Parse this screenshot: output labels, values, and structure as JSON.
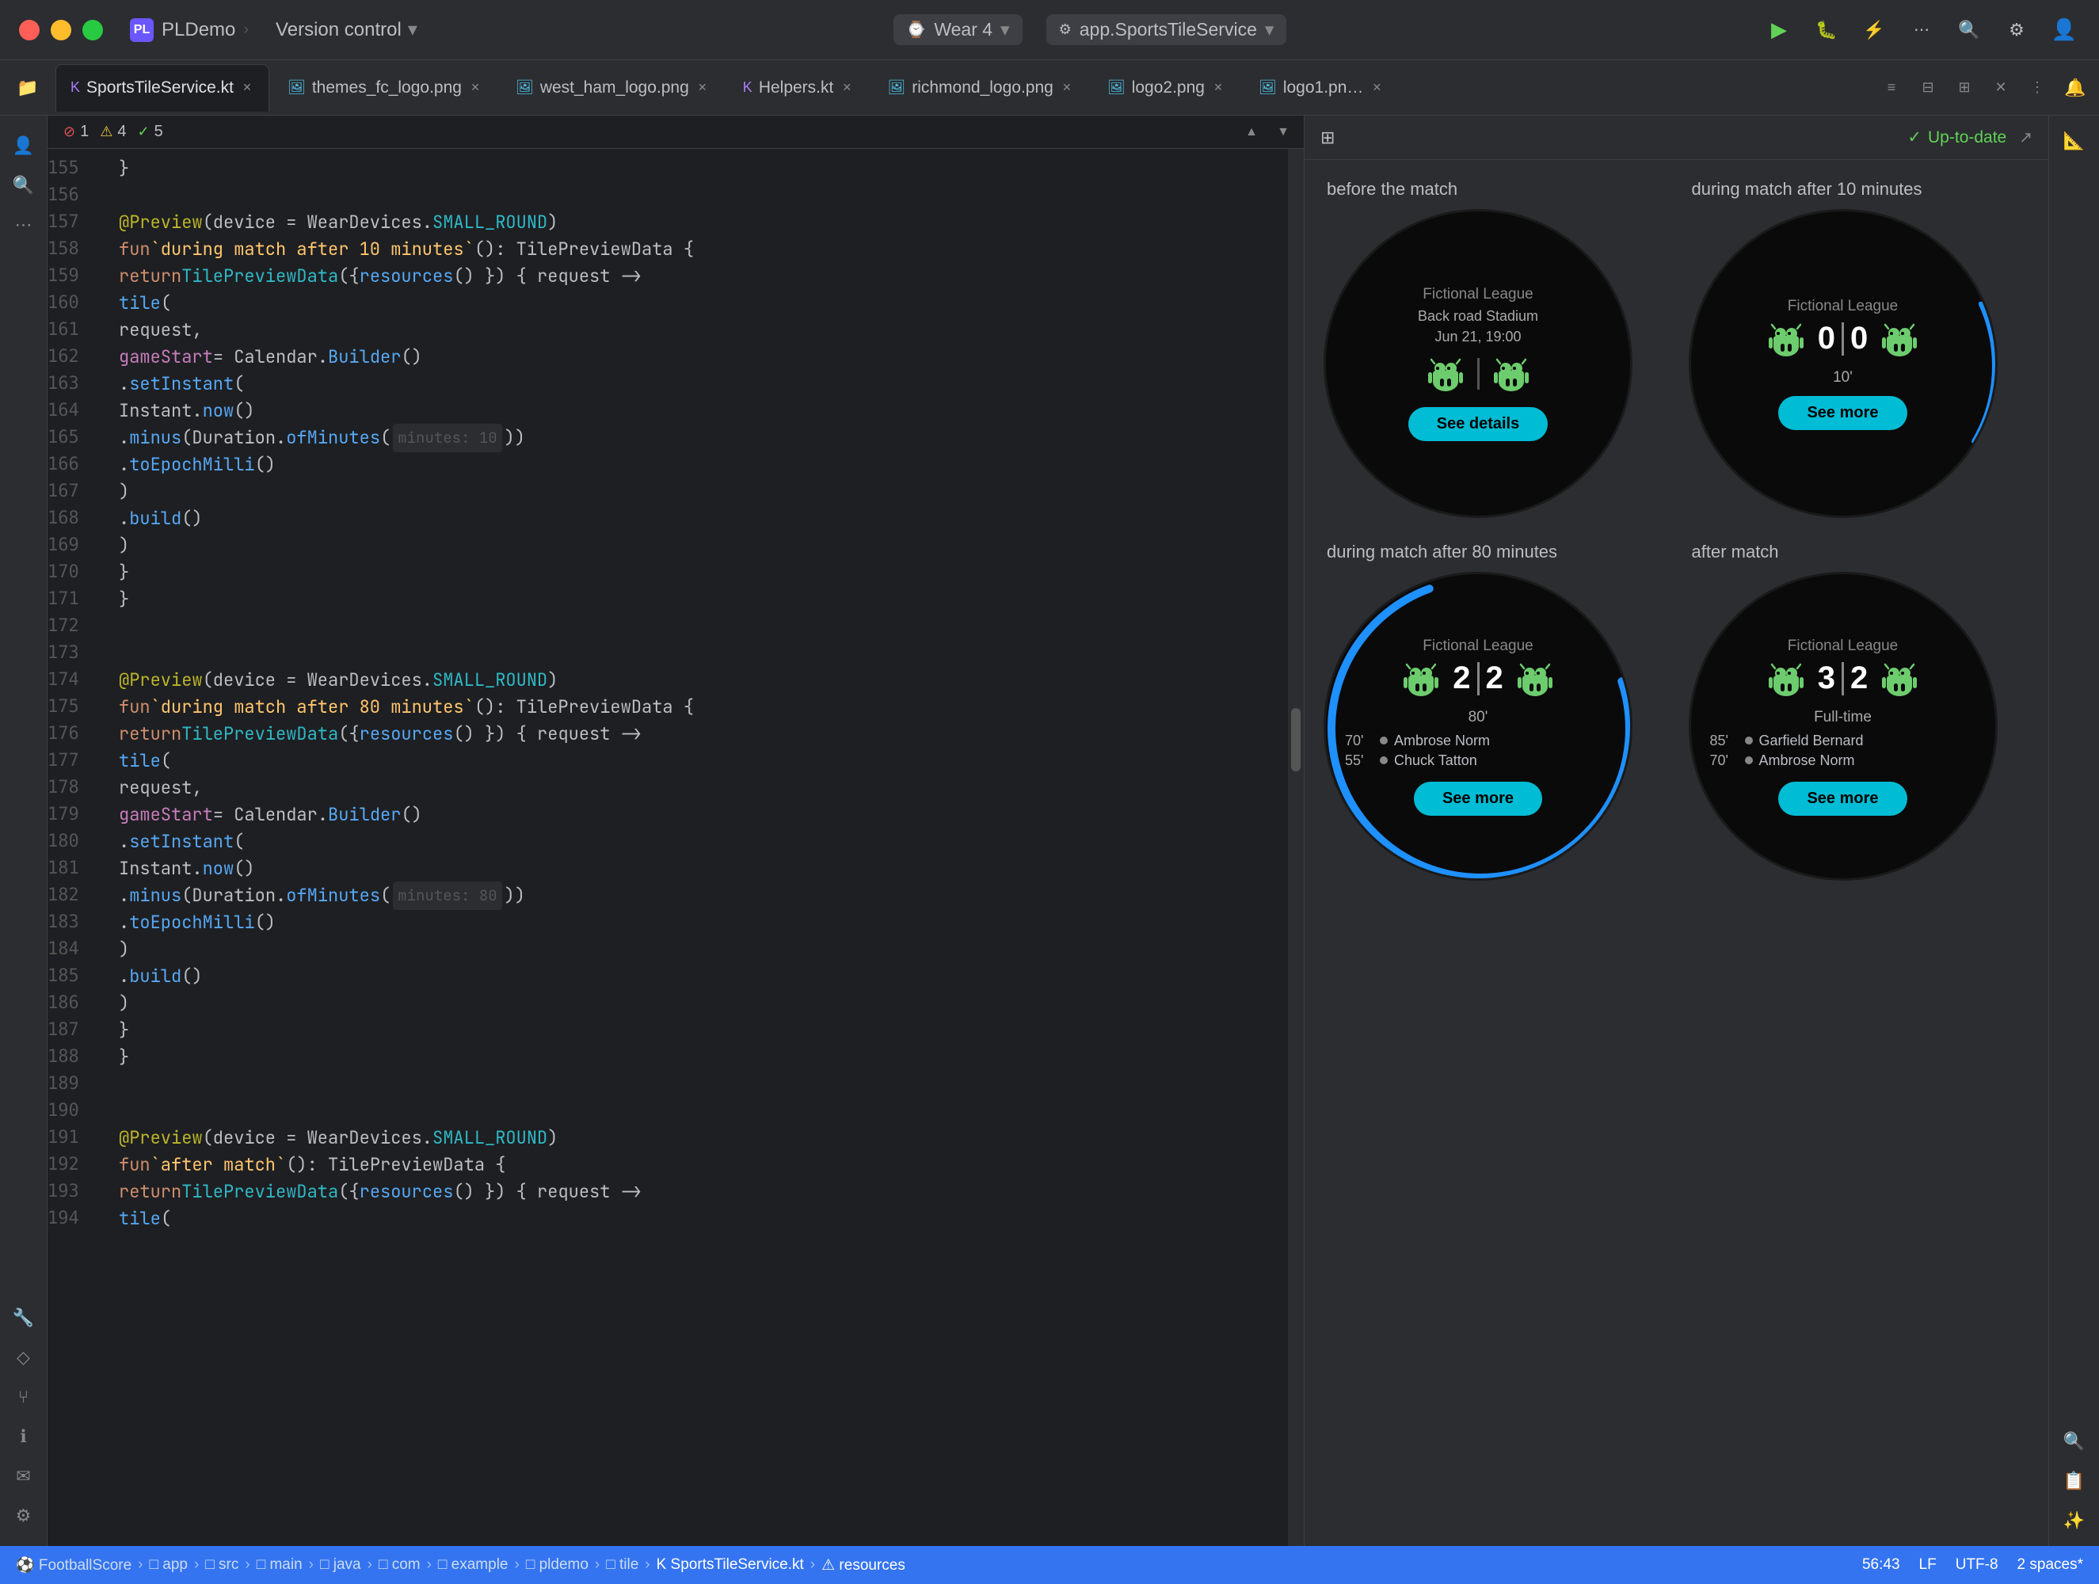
{
  "titlebar": {
    "app_icon": "PL",
    "app_name": "PLDemo",
    "vc_label": "Version control",
    "wear_label": "Wear 4",
    "service_label": "app.SportsTileService",
    "run_btn": "▶",
    "debug_btn": "🐛",
    "more_btn": "⋯"
  },
  "tabs": [
    {
      "id": "sports",
      "label": "SportsTileService.kt",
      "icon": "kt",
      "active": true
    },
    {
      "id": "themes",
      "label": "themes_fc_logo.png",
      "icon": "png"
    },
    {
      "id": "westham",
      "label": "west_ham_logo.png",
      "icon": "png"
    },
    {
      "id": "helpers",
      "label": "Helpers.kt",
      "icon": "kt"
    },
    {
      "id": "richmond",
      "label": "richmond_logo.png",
      "icon": "png"
    },
    {
      "id": "logo2",
      "label": "logo2.png",
      "icon": "png"
    },
    {
      "id": "logo1",
      "label": "logo1.pn…",
      "icon": "png"
    }
  ],
  "warnings": {
    "error_count": "1",
    "warning_count": "4",
    "info_count": "5"
  },
  "code": {
    "lines": [
      {
        "num": 155,
        "tokens": [
          {
            "t": "plain",
            "v": "    }"
          }
        ]
      },
      {
        "num": 156,
        "tokens": [
          {
            "t": "plain",
            "v": ""
          }
        ]
      },
      {
        "num": 157,
        "tokens": [
          {
            "t": "ann",
            "v": "@Preview"
          },
          {
            "t": "plain",
            "v": "(device = WearDevices."
          },
          {
            "t": "type",
            "v": "SMALL_ROUND"
          },
          {
            "t": "plain",
            "v": ")"
          }
        ]
      },
      {
        "num": 158,
        "tokens": [
          {
            "t": "kw",
            "v": "fun "
          },
          {
            "t": "fn2",
            "v": "`during match after 10 minutes`"
          },
          {
            "t": "plain",
            "v": "(): TilePreviewData {"
          }
        ]
      },
      {
        "num": 159,
        "tokens": [
          {
            "t": "plain",
            "v": "    "
          },
          {
            "t": "kw",
            "v": "return "
          },
          {
            "t": "type",
            "v": "TilePreviewData"
          },
          {
            "t": "plain",
            "v": "({ "
          },
          {
            "t": "fn",
            "v": "resources"
          },
          {
            "t": "plain",
            "v": "() }) { request ->"
          }
        ]
      },
      {
        "num": 160,
        "tokens": [
          {
            "t": "plain",
            "v": "        "
          },
          {
            "t": "fn",
            "v": "tile"
          },
          {
            "t": "plain",
            "v": "("
          }
        ]
      },
      {
        "num": 161,
        "tokens": [
          {
            "t": "plain",
            "v": "            request,"
          }
        ]
      },
      {
        "num": 162,
        "tokens": [
          {
            "t": "plain",
            "v": "            "
          },
          {
            "t": "param",
            "v": "gameStart"
          },
          {
            "t": "plain",
            "v": " = Calendar."
          },
          {
            "t": "fn",
            "v": "Builder"
          },
          {
            "t": "plain",
            "v": "()"
          }
        ]
      },
      {
        "num": 163,
        "tokens": [
          {
            "t": "plain",
            "v": "                ."
          },
          {
            "t": "fn",
            "v": "setInstant"
          },
          {
            "t": "plain",
            "v": "("
          }
        ]
      },
      {
        "num": 164,
        "tokens": [
          {
            "t": "plain",
            "v": "                    Instant."
          },
          {
            "t": "fn",
            "v": "now"
          },
          {
            "t": "plain",
            "v": "()"
          }
        ]
      },
      {
        "num": 165,
        "tokens": [
          {
            "t": "plain",
            "v": "                        ."
          },
          {
            "t": "fn",
            "v": "minus"
          },
          {
            "t": "plain",
            "v": "(Duration."
          },
          {
            "t": "fn",
            "v": "ofMinutes"
          },
          {
            "t": "plain",
            "v": "("
          },
          {
            "t": "hint",
            "v": "minutes: 10"
          },
          {
            "t": "plain",
            "v": "))"
          }
        ]
      },
      {
        "num": 166,
        "tokens": [
          {
            "t": "plain",
            "v": "                        ."
          },
          {
            "t": "fn",
            "v": "toEpochMilli"
          },
          {
            "t": "plain",
            "v": "()"
          }
        ]
      },
      {
        "num": 167,
        "tokens": [
          {
            "t": "plain",
            "v": "                )"
          }
        ]
      },
      {
        "num": 168,
        "tokens": [
          {
            "t": "plain",
            "v": "                ."
          },
          {
            "t": "fn",
            "v": "build"
          },
          {
            "t": "plain",
            "v": "()"
          }
        ]
      },
      {
        "num": 169,
        "tokens": [
          {
            "t": "plain",
            "v": "        )"
          }
        ]
      },
      {
        "num": 170,
        "tokens": [
          {
            "t": "plain",
            "v": "    }"
          }
        ]
      },
      {
        "num": 171,
        "tokens": [
          {
            "t": "plain",
            "v": "}"
          }
        ]
      },
      {
        "num": 172,
        "tokens": [
          {
            "t": "plain",
            "v": ""
          }
        ]
      },
      {
        "num": 173,
        "tokens": [
          {
            "t": "plain",
            "v": ""
          }
        ]
      },
      {
        "num": 174,
        "tokens": [
          {
            "t": "ann",
            "v": "@Preview"
          },
          {
            "t": "plain",
            "v": "(device = WearDevices."
          },
          {
            "t": "type",
            "v": "SMALL_ROUND"
          },
          {
            "t": "plain",
            "v": ")"
          }
        ]
      },
      {
        "num": 175,
        "tokens": [
          {
            "t": "kw",
            "v": "fun "
          },
          {
            "t": "fn2",
            "v": "`during match after 80 minutes`"
          },
          {
            "t": "plain",
            "v": "(): TilePreviewData {"
          }
        ]
      },
      {
        "num": 176,
        "tokens": [
          {
            "t": "plain",
            "v": "    "
          },
          {
            "t": "kw",
            "v": "return "
          },
          {
            "t": "type",
            "v": "TilePreviewData"
          },
          {
            "t": "plain",
            "v": "({ "
          },
          {
            "t": "fn",
            "v": "resources"
          },
          {
            "t": "plain",
            "v": "() }) { request ->"
          }
        ]
      },
      {
        "num": 177,
        "tokens": [
          {
            "t": "plain",
            "v": "        "
          },
          {
            "t": "fn",
            "v": "tile"
          },
          {
            "t": "plain",
            "v": "("
          }
        ]
      },
      {
        "num": 178,
        "tokens": [
          {
            "t": "plain",
            "v": "            request,"
          }
        ]
      },
      {
        "num": 179,
        "tokens": [
          {
            "t": "plain",
            "v": "            "
          },
          {
            "t": "param",
            "v": "gameStart"
          },
          {
            "t": "plain",
            "v": " = Calendar."
          },
          {
            "t": "fn",
            "v": "Builder"
          },
          {
            "t": "plain",
            "v": "()"
          }
        ]
      },
      {
        "num": 180,
        "tokens": [
          {
            "t": "plain",
            "v": "                ."
          },
          {
            "t": "fn",
            "v": "setInstant"
          },
          {
            "t": "plain",
            "v": "("
          }
        ]
      },
      {
        "num": 181,
        "tokens": [
          {
            "t": "plain",
            "v": "                    Instant."
          },
          {
            "t": "fn",
            "v": "now"
          },
          {
            "t": "plain",
            "v": "()"
          }
        ]
      },
      {
        "num": 182,
        "tokens": [
          {
            "t": "plain",
            "v": "                        ."
          },
          {
            "t": "fn",
            "v": "minus"
          },
          {
            "t": "plain",
            "v": "(Duration."
          },
          {
            "t": "fn",
            "v": "ofMinutes"
          },
          {
            "t": "plain",
            "v": "("
          },
          {
            "t": "hint",
            "v": "minutes: 80"
          },
          {
            "t": "plain",
            "v": "))"
          }
        ]
      },
      {
        "num": 183,
        "tokens": [
          {
            "t": "plain",
            "v": "                        ."
          },
          {
            "t": "fn",
            "v": "toEpochMilli"
          },
          {
            "t": "plain",
            "v": "()"
          }
        ]
      },
      {
        "num": 184,
        "tokens": [
          {
            "t": "plain",
            "v": "                )"
          }
        ]
      },
      {
        "num": 185,
        "tokens": [
          {
            "t": "plain",
            "v": "                ."
          },
          {
            "t": "fn",
            "v": "build"
          },
          {
            "t": "plain",
            "v": "()"
          }
        ]
      },
      {
        "num": 186,
        "tokens": [
          {
            "t": "plain",
            "v": "        )"
          }
        ]
      },
      {
        "num": 187,
        "tokens": [
          {
            "t": "plain",
            "v": "    }"
          }
        ]
      },
      {
        "num": 188,
        "tokens": [
          {
            "t": "plain",
            "v": "}"
          }
        ]
      },
      {
        "num": 189,
        "tokens": [
          {
            "t": "plain",
            "v": ""
          }
        ]
      },
      {
        "num": 190,
        "tokens": [
          {
            "t": "plain",
            "v": ""
          }
        ]
      },
      {
        "num": 191,
        "tokens": [
          {
            "t": "ann",
            "v": "@Preview"
          },
          {
            "t": "plain",
            "v": "(device = WearDevices."
          },
          {
            "t": "type",
            "v": "SMALL_ROUND"
          },
          {
            "t": "plain",
            "v": ")"
          }
        ]
      },
      {
        "num": 192,
        "tokens": [
          {
            "t": "kw",
            "v": "fun "
          },
          {
            "t": "fn2",
            "v": "`after match`"
          },
          {
            "t": "plain",
            "v": "(): TilePreviewData {"
          }
        ]
      },
      {
        "num": 193,
        "tokens": [
          {
            "t": "plain",
            "v": "    "
          },
          {
            "t": "kw",
            "v": "return "
          },
          {
            "t": "type",
            "v": "TilePreviewData"
          },
          {
            "t": "plain",
            "v": "({ "
          },
          {
            "t": "fn",
            "v": "resources"
          },
          {
            "t": "plain",
            "v": "() }) { request ->"
          }
        ]
      },
      {
        "num": 194,
        "tokens": [
          {
            "t": "plain",
            "v": "        "
          },
          {
            "t": "fn",
            "v": "tile"
          },
          {
            "t": "plain",
            "v": "("
          }
        ]
      }
    ]
  },
  "preview": {
    "uptodate_label": "Up-to-date",
    "tiles": [
      {
        "id": "before-match",
        "label": "before the match",
        "league": "Fictional League",
        "venue": "Back road Stadium",
        "datetime": "Jun 21, 19:00",
        "btn_label": "See details",
        "type": "pre"
      },
      {
        "id": "during-10",
        "label": "during match after 10 minutes",
        "league": "Fictional League",
        "score_home": "0",
        "score_away": "0",
        "minute": "10'",
        "btn_label": "See more",
        "type": "live",
        "ring": "small"
      },
      {
        "id": "during-80",
        "label": "during match after 80 minutes",
        "league": "Fictional League",
        "score_home": "2",
        "score_away": "2",
        "minute": "80'",
        "events": [
          {
            "minute": "70'",
            "player": "Ambrose Norm"
          },
          {
            "minute": "55'",
            "player": "Chuck Tatton"
          }
        ],
        "btn_label": "See more",
        "type": "live",
        "ring": "large"
      },
      {
        "id": "after-match",
        "label": "after match",
        "league": "Fictional League",
        "score_home": "3",
        "score_away": "2",
        "status": "Full-time",
        "events": [
          {
            "minute": "85'",
            "player": "Garfield Bernard"
          },
          {
            "minute": "70'",
            "player": "Ambrose Norm"
          }
        ],
        "btn_label": "See more",
        "type": "post"
      }
    ]
  },
  "statusbar": {
    "breadcrumbs": [
      "FootballScore",
      "app",
      "src",
      "main",
      "java",
      "com",
      "example",
      "pldemo",
      "tile",
      "SportsTileService.kt",
      "resources"
    ],
    "position": "56:43",
    "encoding": "UTF-8",
    "line_separator": "LF",
    "indent": "2 spaces*"
  }
}
